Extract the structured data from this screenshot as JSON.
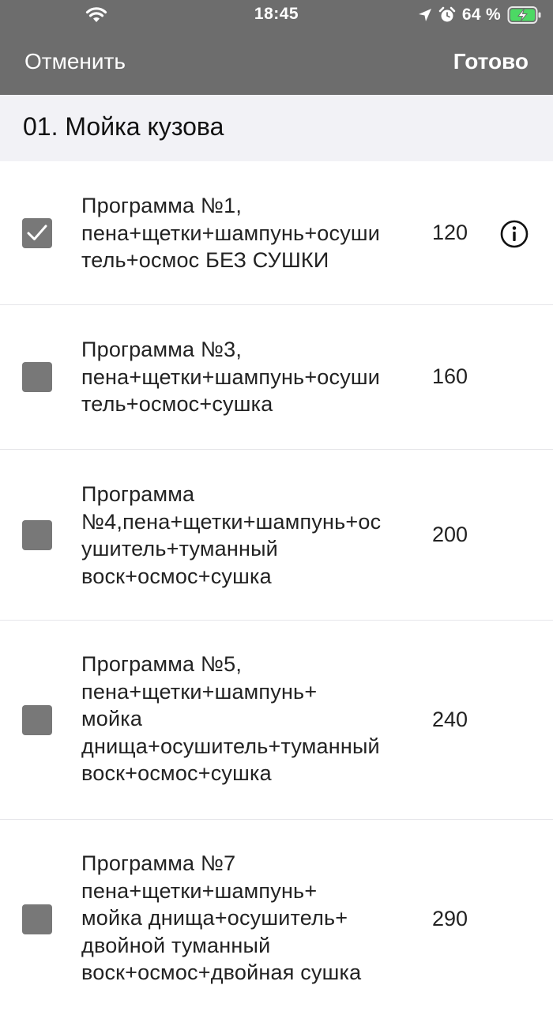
{
  "status_bar": {
    "time": "18:45",
    "battery_percent": "64 %",
    "icons": [
      "wifi-icon",
      "location-arrow-icon",
      "alarm-icon",
      "battery-charging-icon"
    ]
  },
  "nav": {
    "cancel_label": "Отменить",
    "done_label": "Готово"
  },
  "section": {
    "title": "01. Мойка кузова"
  },
  "colors": {
    "navbar_bg": "#6d6d6d",
    "section_bg": "#f2f2f6",
    "checkbox_bg": "#787878"
  },
  "items": [
    {
      "title": "Программа №1,\nпена+щетки+шампунь+осуши\nтель+осмос БЕЗ СУШКИ",
      "price": "120",
      "checked": true,
      "has_info": true
    },
    {
      "title": "Программа №3,\nпена+щетки+шампунь+осуши\nтель+осмос+сушка",
      "price": "160",
      "checked": false,
      "has_info": false
    },
    {
      "title": "Программа\n№4,пена+щетки+шампунь+ос\nушитель+туманный\nвоск+осмос+сушка",
      "price": "200",
      "checked": false,
      "has_info": false
    },
    {
      "title": "Программа №5,\nпена+щетки+шампунь+\nмойка\nднища+осушитель+туманный\nвоск+осмос+сушка",
      "price": "240",
      "checked": false,
      "has_info": false
    },
    {
      "title": "Программа №7\nпена+щетки+шампунь+\nмойка днища+осушитель+\nдвойной туманный\nвоск+осмос+двойная сушка",
      "price": "290",
      "checked": false,
      "has_info": false
    }
  ]
}
